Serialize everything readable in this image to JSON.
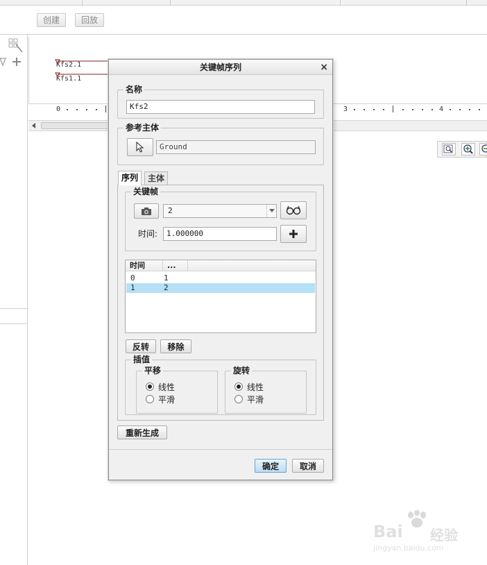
{
  "toolbar": {
    "create_label": "创建",
    "playback_label": "回放"
  },
  "ruler": {
    "ticks": [
      "0",
      "3",
      "4"
    ]
  },
  "tracks": [
    "Kfs2.1",
    "Kfs1.1"
  ],
  "dialog": {
    "title": "关键帧序列",
    "name_group": {
      "label": "名称",
      "value": "Kfs2"
    },
    "ref_group": {
      "label": "参考主体",
      "value": "Ground"
    },
    "tabs": [
      {
        "label": "序列"
      },
      {
        "label": "主体"
      }
    ],
    "keyframe_group": {
      "label": "关键帧",
      "selected_keyframe": "2",
      "time_label": "时间:",
      "time_value": "1.000000"
    },
    "table": {
      "headers": [
        "时间",
        "..."
      ],
      "rows": [
        [
          "0",
          "1"
        ],
        [
          "1",
          "2"
        ]
      ],
      "selected_row": 1
    },
    "reverse_label": "反转",
    "remove_label": "移除",
    "interp_group": {
      "label": "插值",
      "translate": {
        "label": "平移",
        "options": [
          "线性",
          "平滑"
        ],
        "selected": 0
      },
      "rotate": {
        "label": "旋转",
        "options": [
          "线性",
          "平滑"
        ],
        "selected": 0
      }
    },
    "regenerate_label": "重新生成",
    "ok_label": "确定",
    "cancel_label": "取消"
  },
  "watermark": {
    "brand": "Bai",
    "brand_suffix": "经验",
    "url": "jingyan.baidu.com"
  },
  "colors": {
    "selection": "#b5e0f6",
    "primary_button": "#bcdcf3",
    "track_marker": "#8b1a1a"
  }
}
